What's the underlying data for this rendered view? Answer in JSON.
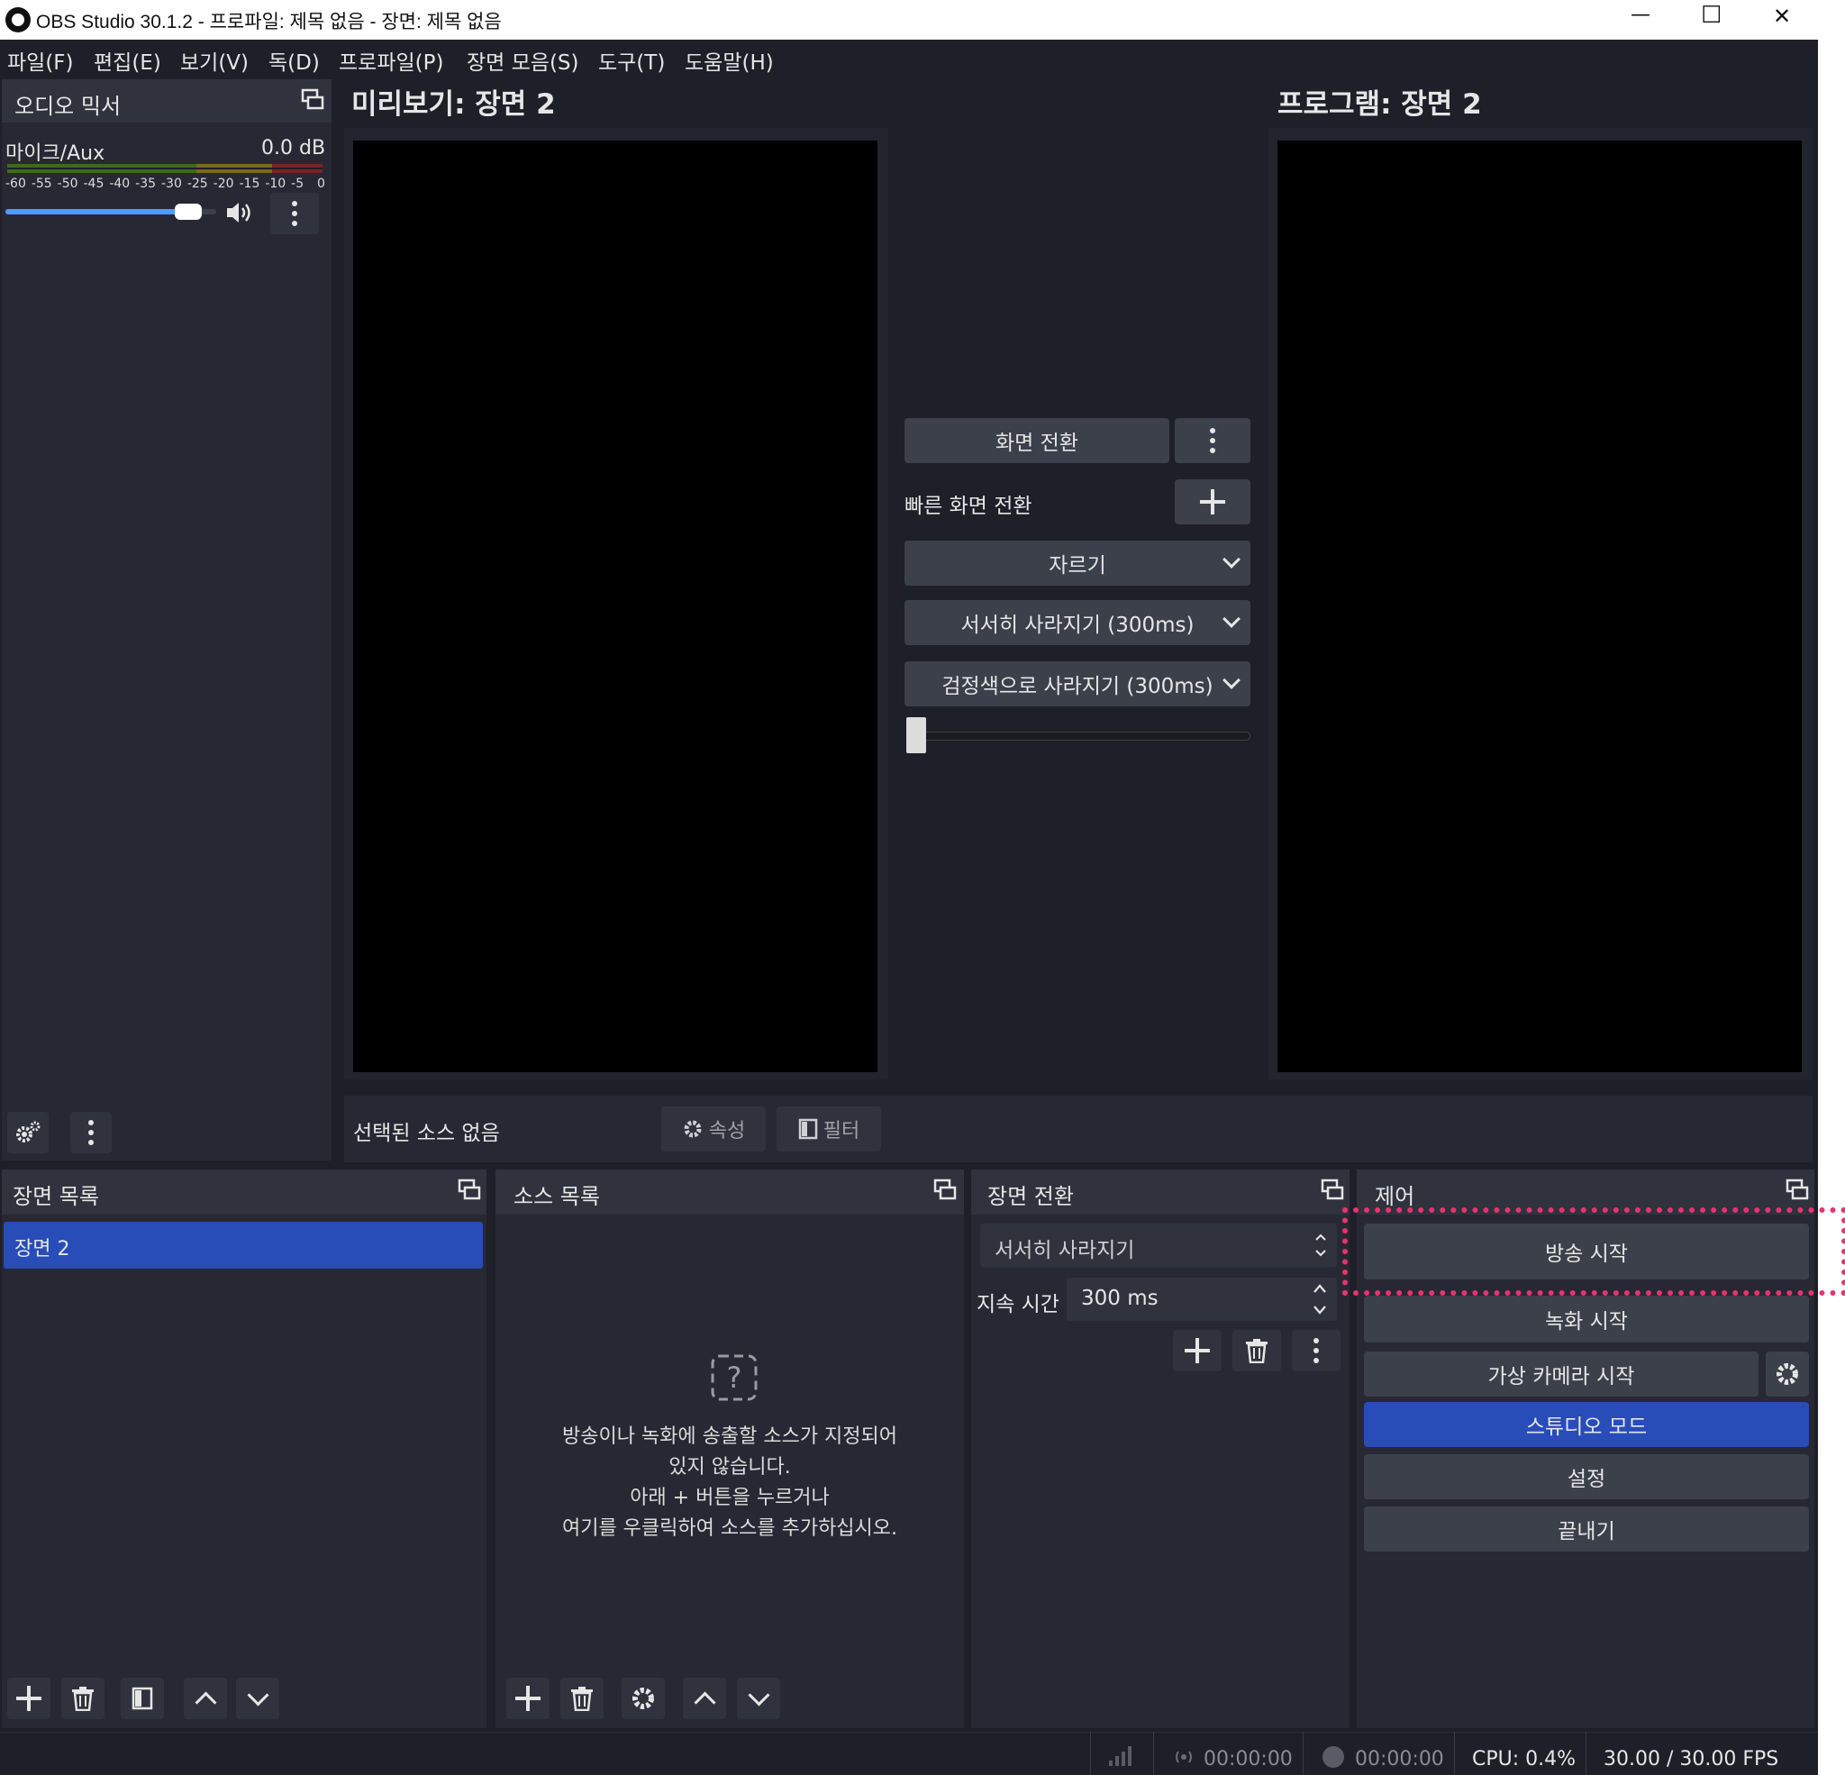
{
  "window": {
    "title": "OBS Studio 30.1.2 - 프로파일: 제목 없음 - 장면: 제목 없음",
    "minimize": "—",
    "maximize": "☐",
    "close": "✕"
  },
  "menubar": [
    "파일(F)",
    "편집(E)",
    "보기(V)",
    "독(D)",
    "프로파일(P)",
    "장면 모음(S)",
    "도구(T)",
    "도움말(H)"
  ],
  "audio_mixer": {
    "title": "오디오 믹서",
    "channel_name": "마이크/Aux",
    "level": "0.0 dB",
    "scale": [
      "-60",
      "-55",
      "-50",
      "-45",
      "-40",
      "-35",
      "-30",
      "-25",
      "-20",
      "-15",
      "-10",
      "-5",
      "0"
    ],
    "volume_fraction": 0.92
  },
  "preview": {
    "title": "미리보기: 장면 2"
  },
  "program": {
    "title": "프로그램: 장면 2"
  },
  "transition_center": {
    "transition_button": "화면 전환",
    "quick_transitions_label": "빠른 화면 전환",
    "items": [
      "자르기",
      "서서히 사라지기 (300ms)",
      "검정색으로 사라지기 (300ms)"
    ],
    "tbar_fraction": 0.0
  },
  "source_toolbar": {
    "no_source": "선택된 소스 없음",
    "properties": "속성",
    "filters": "필터"
  },
  "scenes": {
    "title": "장면 목록",
    "items": [
      "장면 2"
    ]
  },
  "sources": {
    "title": "소스 목록",
    "empty_lines": [
      "방송이나 녹화에 송출할 소스가 지정되어",
      "있지 않습니다.",
      "아래 + 버튼을 누르거나",
      "여기를 우클릭하여 소스를 추가하십시오."
    ]
  },
  "scene_transitions": {
    "title": "장면 전환",
    "selected": "서서히 사라지기",
    "duration_label": "지속 시간",
    "duration_value": "300 ms"
  },
  "controls": {
    "title": "제어",
    "start_streaming": "방송 시작",
    "start_recording": "녹화 시작",
    "start_virtual_camera": "가상 카메라 시작",
    "studio_mode": "스튜디오 모드",
    "settings": "설정",
    "exit": "끝내기"
  },
  "statusbar": {
    "stream_time": "00:00:00",
    "record_time": "00:00:00",
    "cpu": "CPU: 0.4%",
    "fps": "30.00 / 30.00 FPS"
  },
  "colors": {
    "background": "#1e1f29",
    "panel": "#272833",
    "button": "#3c404b",
    "accent_blue": "#284cb8",
    "highlight": "#e8336f"
  }
}
